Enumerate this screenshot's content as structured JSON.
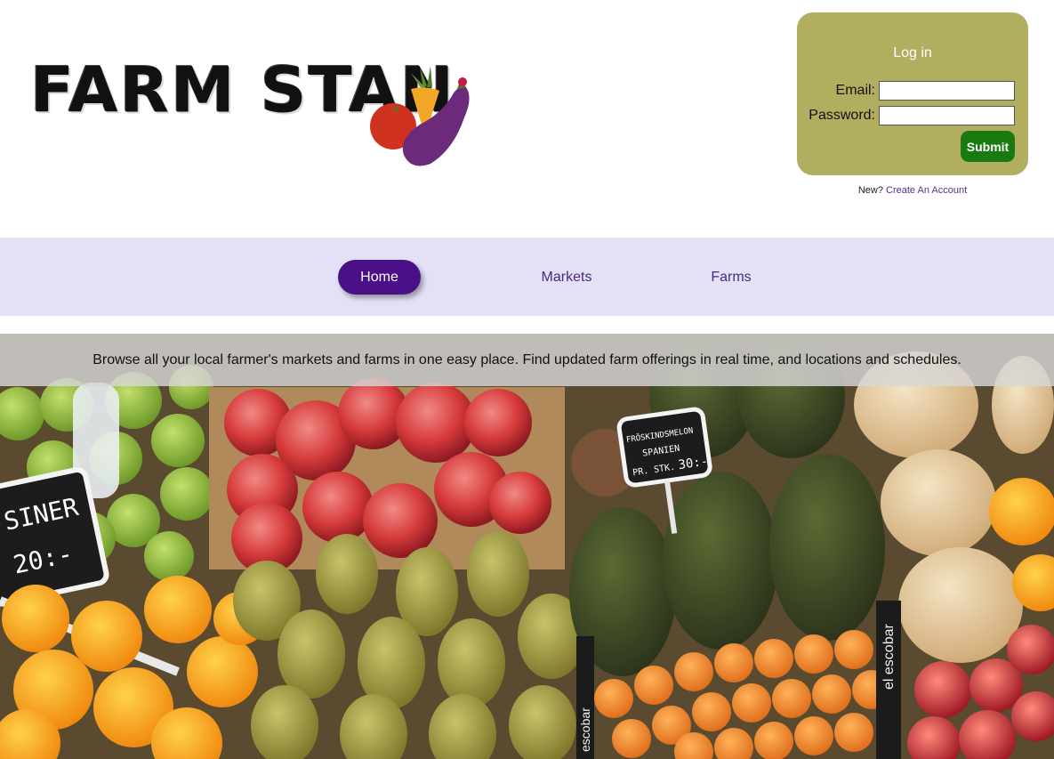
{
  "logo": {
    "text": "FARM STAN"
  },
  "login": {
    "title": "Log in",
    "email_label": "Email:",
    "email_value": "",
    "password_label": "Password:",
    "password_value": "",
    "submit_label": "Submit",
    "new_label": "New?",
    "create_link": "Create An Account"
  },
  "nav": {
    "items": [
      {
        "label": "Home",
        "active": true
      },
      {
        "label": "Markets",
        "active": false
      },
      {
        "label": "Farms",
        "active": false
      }
    ]
  },
  "hero": {
    "tagline": "Browse all your local farmer's markets and farms in one easy place. Find updated farm offerings in real time, and locations and schedules.",
    "signs": [
      "SINER",
      "20:-",
      "FRÖSKINDSMELON",
      "SPANIEN",
      "PR. STK.",
      "30:-",
      "el escobar",
      "escobar"
    ]
  },
  "colors": {
    "login_bg": "#b2ae60",
    "submit_bg": "#1a7a12",
    "nav_bg": "#e3e1f5",
    "nav_active": "#4b0f87",
    "link": "#5a2d91"
  }
}
